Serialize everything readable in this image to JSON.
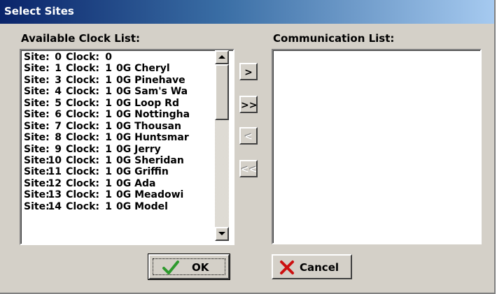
{
  "window": {
    "title": "Select Sites"
  },
  "available_list": {
    "label": "Available Clock List:",
    "items": [
      {
        "site_label": "Site:",
        "site": "0",
        "clock_label": "Clock:",
        "clock": "0",
        "name": ""
      },
      {
        "site_label": "Site:",
        "site": "1",
        "clock_label": "Clock:",
        "clock": "1",
        "name": "0G Cheryl"
      },
      {
        "site_label": "Site:",
        "site": "3",
        "clock_label": "Clock:",
        "clock": "1",
        "name": "0G Pinehave"
      },
      {
        "site_label": "Site:",
        "site": "4",
        "clock_label": "Clock:",
        "clock": "1",
        "name": "0G Sam's Wa"
      },
      {
        "site_label": "Site:",
        "site": "5",
        "clock_label": "Clock:",
        "clock": "1",
        "name": "0G Loop Rd"
      },
      {
        "site_label": "Site:",
        "site": "6",
        "clock_label": "Clock:",
        "clock": "1",
        "name": "0G Nottingha"
      },
      {
        "site_label": "Site:",
        "site": "7",
        "clock_label": "Clock:",
        "clock": "1",
        "name": "0G Thousan"
      },
      {
        "site_label": "Site:",
        "site": "8",
        "clock_label": "Clock:",
        "clock": "1",
        "name": "0G Huntsmar"
      },
      {
        "site_label": "Site:",
        "site": "9",
        "clock_label": "Clock:",
        "clock": "1",
        "name": "0G Jerry"
      },
      {
        "site_label": "Site:",
        "site": "10",
        "clock_label": "Clock:",
        "clock": "1",
        "name": "0G Sheridan"
      },
      {
        "site_label": "Site:",
        "site": "11",
        "clock_label": "Clock:",
        "clock": "1",
        "name": "0G Griffin"
      },
      {
        "site_label": "Site:",
        "site": "12",
        "clock_label": "Clock:",
        "clock": "1",
        "name": "0G Ada"
      },
      {
        "site_label": "Site:",
        "site": "13",
        "clock_label": "Clock:",
        "clock": "1",
        "name": "0G Meadowi"
      },
      {
        "site_label": "Site:",
        "site": "14",
        "clock_label": "Clock:",
        "clock": "1",
        "name": "0G Model"
      }
    ]
  },
  "communication_list": {
    "label": "Communication List:",
    "items": []
  },
  "move_buttons": [
    {
      "label": ">",
      "enabled": true
    },
    {
      "label": ">>",
      "enabled": true
    },
    {
      "label": "<",
      "enabled": false
    },
    {
      "label": "<<",
      "enabled": false
    }
  ],
  "buttons": {
    "ok": {
      "label": "OK",
      "icon": "checkmark-icon"
    },
    "cancel": {
      "label": "Cancel",
      "icon": "x-icon"
    }
  },
  "colors": {
    "title_bar_start": "#0a246a",
    "title_bar_end": "#a6caf0",
    "dialog_face": "#d4d0c8",
    "ok_check": "#2e9a2e",
    "cancel_x": "#cc1010"
  }
}
